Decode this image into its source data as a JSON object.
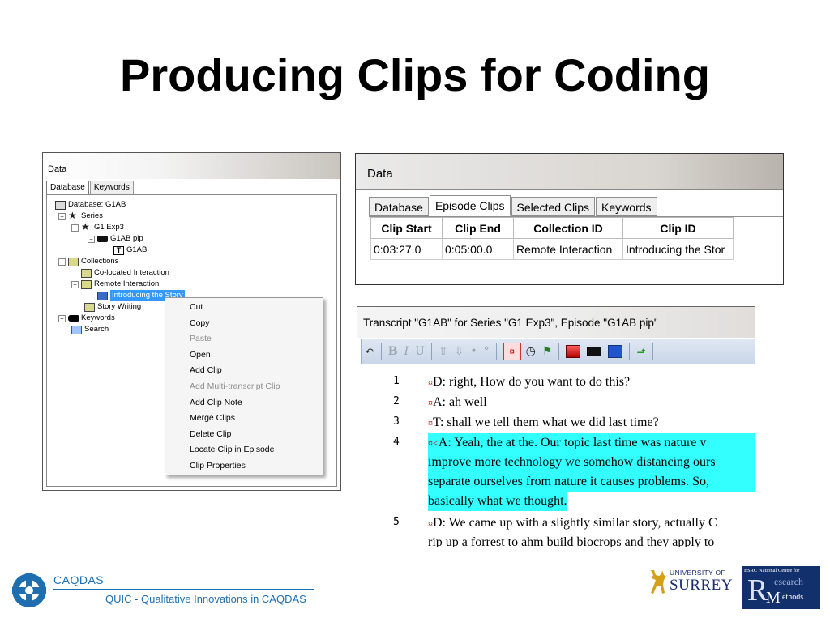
{
  "slide": {
    "title": "Producing Clips for Coding"
  },
  "tree_window": {
    "title": "Data",
    "tabs": [
      "Database",
      "Keywords"
    ],
    "nodes": [
      {
        "label": "Database: G1AB"
      },
      {
        "label": "Series"
      },
      {
        "label": "G1 Exp3"
      },
      {
        "label": "G1AB pip"
      },
      {
        "label": "G1AB"
      },
      {
        "label": "Collections"
      },
      {
        "label": "Co-located Interaction"
      },
      {
        "label": "Remote Interaction"
      },
      {
        "label": "Introducing the Story"
      },
      {
        "label": "Story Writing"
      },
      {
        "label": "Keywords"
      },
      {
        "label": "Search"
      }
    ]
  },
  "context_menu": {
    "items": [
      {
        "label": "Cut",
        "enabled": true
      },
      {
        "label": "Copy",
        "enabled": true
      },
      {
        "label": "Paste",
        "enabled": false
      },
      {
        "label": "Open",
        "enabled": true
      },
      {
        "label": "Add Clip",
        "enabled": true
      },
      {
        "label": "Add Multi-transcript Clip",
        "enabled": false
      },
      {
        "label": "Add Clip Note",
        "enabled": true
      },
      {
        "label": "Merge Clips",
        "enabled": true
      },
      {
        "label": "Delete Clip",
        "enabled": true
      },
      {
        "label": "Locate Clip in Episode",
        "enabled": true
      },
      {
        "label": "Clip Properties",
        "enabled": true
      }
    ]
  },
  "clips_window": {
    "title": "Data",
    "tabs": [
      "Database",
      "Episode Clips",
      "Selected Clips",
      "Keywords"
    ],
    "active_tab": "Episode Clips",
    "columns": [
      "Clip Start",
      "Clip End",
      "Collection ID",
      "Clip ID"
    ],
    "rows": [
      [
        "0:03:27.0",
        "0:05:00.0",
        "Remote Interaction",
        "Introducing the Stor"
      ]
    ]
  },
  "transcript_window": {
    "title": "Transcript \"G1AB\" for Series \"G1 Exp3\", Episode \"G1AB pip\"",
    "toolbar": {
      "bold": "B",
      "italic": "I",
      "underline": "U"
    },
    "line_numbers": [
      "1",
      "2",
      "3",
      "4",
      "5"
    ],
    "lines": [
      {
        "mark": "¤",
        "text": "D: right, How do you want to do this?",
        "highlight": false
      },
      {
        "mark": "¤",
        "text": "A: ah well",
        "highlight": false
      },
      {
        "mark": "¤",
        "text": "T: shall we tell them what we did last time?",
        "highlight": false
      },
      {
        "mark": "¤<",
        "text": "A: Yeah, the at the. Our topic last time was nature v",
        "highlight": true
      },
      {
        "mark": "",
        "text": "improve more technology we somehow distancing ours",
        "highlight": true
      },
      {
        "mark": "",
        "text": "separate ourselves from nature it causes problems. So,",
        "highlight": true
      },
      {
        "mark": "",
        "text": "basically what we thought.",
        "highlight": true
      },
      {
        "mark": "¤",
        "text": "D: We came up with a slightly similar story, actually C",
        "highlight": false
      },
      {
        "mark": "",
        "text": "rip up a forrest to ahm build biocrops and they apply to",
        "highlight": false
      }
    ]
  },
  "footer": {
    "caqdas_name": "CAQDAS",
    "caqdas_tagline": "QUIC - Qualitative Innovations in CAQDAS",
    "surrey_uni": "UNIVERSITY OF",
    "surrey_name": "SURREY",
    "esrc_top": "ESRC National Centre for",
    "esrc_r": "R",
    "esrc_research": "esearch",
    "esrc_m": "M",
    "esrc_methods": "ethods"
  },
  "colors": {
    "highlight": "#33ffff",
    "selection": "#3399ff",
    "caqdas_blue": "#1f6fb0",
    "surrey_navy": "#1a2b6e",
    "esrc_navy": "#12306b"
  }
}
